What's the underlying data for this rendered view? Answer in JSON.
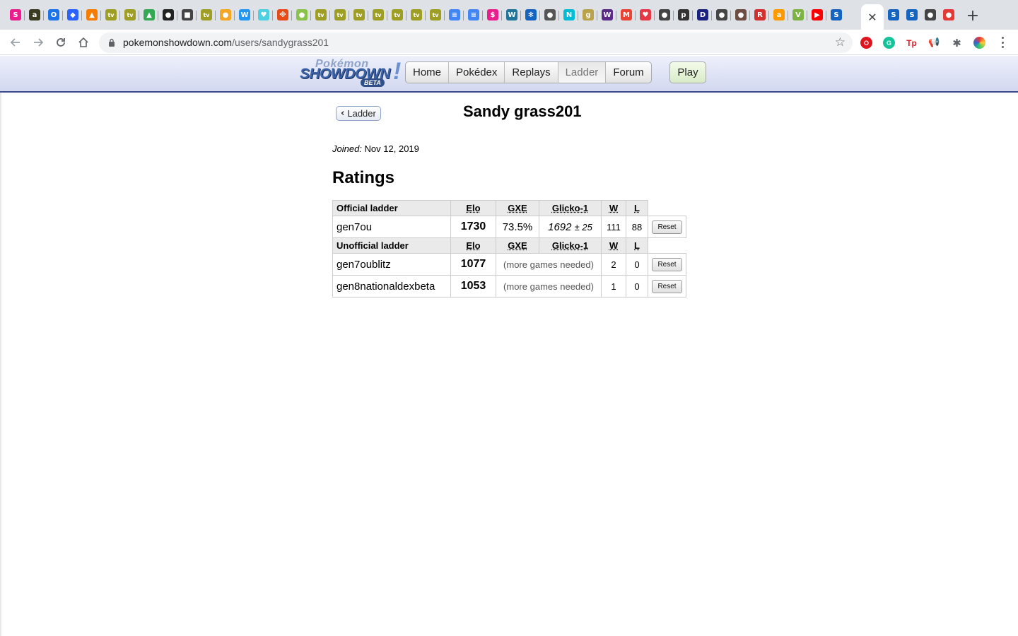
{
  "browser": {
    "url_host": "pokemonshowdown.com",
    "url_path": "/users/sandygrass201",
    "tab_glyphs": [
      "S",
      "a",
      "O",
      "◆",
      "▲",
      "tv",
      "tv",
      "▲",
      "●",
      "■",
      "tv",
      "●",
      "W",
      "♥",
      "※",
      "●",
      "tv",
      "tv",
      "tv",
      "tv",
      "tv",
      "tv",
      "tv",
      "≡",
      "≡",
      "$",
      "W",
      "✻",
      "●",
      "N",
      "g",
      "W",
      "M",
      "♥",
      "●",
      "p",
      "D",
      "●",
      "●",
      "R",
      "a",
      "V",
      "▶",
      "S"
    ],
    "after_active_glyphs": [
      "S",
      "S",
      "●",
      "●"
    ],
    "close_glyph": "✕",
    "new_tab_glyph": "+",
    "star_glyph": "☆"
  },
  "site": {
    "logo": {
      "line1": "Pokémon",
      "line2": "SHOWDOWN",
      "bang": "!",
      "badge": "BETA"
    },
    "nav": [
      {
        "label": "Home"
      },
      {
        "label": "Pokédex"
      },
      {
        "label": "Replays"
      },
      {
        "label": "Ladder",
        "current": true
      },
      {
        "label": "Forum"
      }
    ],
    "play_label": "Play"
  },
  "profile": {
    "back_label": "Ladder",
    "name": "Sandy grass201",
    "joined_label": "Joined:",
    "joined_date": "Nov 12, 2019",
    "ratings_heading": "Ratings"
  },
  "ratings": {
    "columns": [
      "Elo",
      "GXE",
      "Glicko-1",
      "W",
      "L"
    ],
    "official_heading": "Official ladder",
    "unofficial_heading": "Unofficial ladder",
    "reset_label": "Reset",
    "official": [
      {
        "format": "gen7ou",
        "elo": "1730",
        "gxe": "73.5%",
        "glicko": "1692",
        "glicko_dev": "± 25",
        "w": "111",
        "l": "88"
      }
    ],
    "unofficial": [
      {
        "format": "gen7oublitz",
        "elo": "1077",
        "note": "(more games needed)",
        "w": "2",
        "l": "0"
      },
      {
        "format": "gen8nationaldexbeta",
        "elo": "1053",
        "note": "(more games needed)",
        "w": "1",
        "l": "0"
      }
    ]
  }
}
